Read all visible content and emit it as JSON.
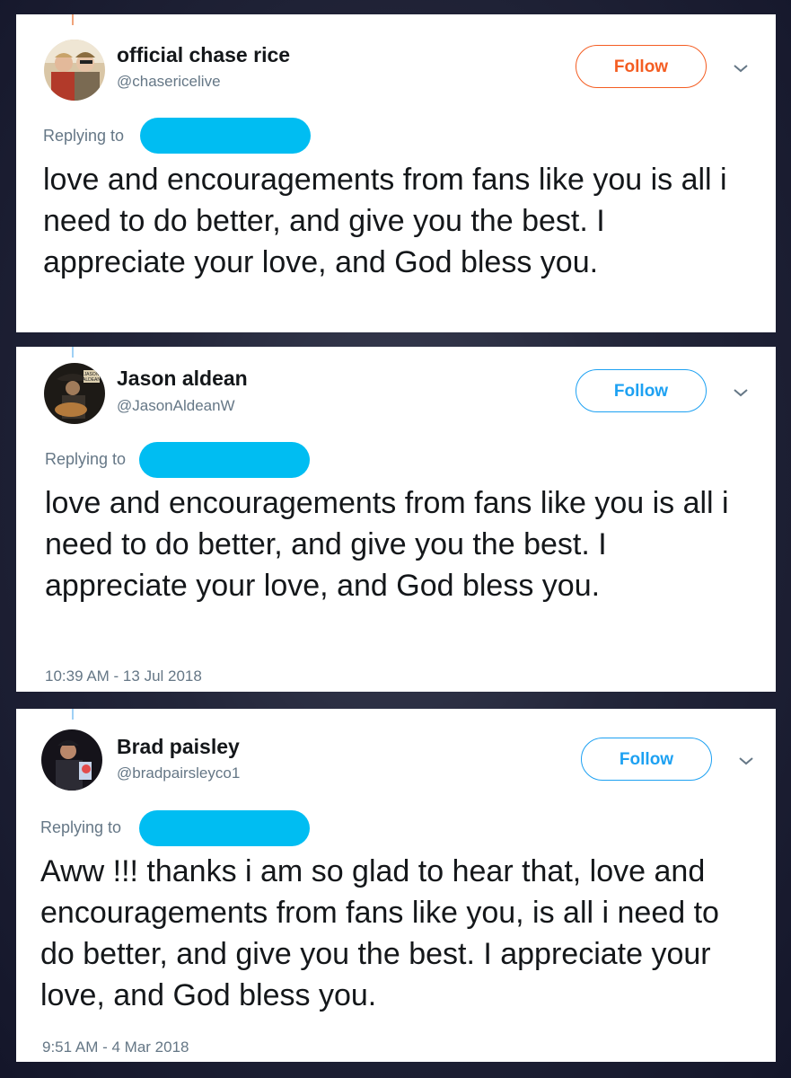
{
  "tweets": [
    {
      "display_name": "official chase rice",
      "handle": "@chasericelive",
      "follow_label": "Follow",
      "reply_label": "Replying to",
      "text": "love and encouragements from fans like you is all i need to do better, and give you the best. I appreciate your love, and God bless you.",
      "timestamp": "",
      "accent": "#f45d22"
    },
    {
      "display_name": "Jason aldean",
      "handle": "@JasonAldeanW",
      "follow_label": "Follow",
      "reply_label": "Replying to",
      "text": "love and encouragements from fans like you is all i need to do better, and give you the best. I appreciate your love, and God bless you.",
      "timestamp": "10:39 AM - 13 Jul 2018",
      "accent": "#1da1f2"
    },
    {
      "display_name": "Brad paisley",
      "handle": "@bradpairsleyco1",
      "follow_label": "Follow",
      "reply_label": "Replying to",
      "text": "Aww !!! thanks i am so glad to hear that, love and encouragements from fans like you, is all i need to do better, and give you the best. I appreciate your love, and God bless you.",
      "timestamp": "9:51 AM - 4 Mar 2018",
      "accent": "#1da1f2"
    }
  ],
  "icons": {
    "more": "chevron-down-icon",
    "redaction": "redacted-username"
  }
}
